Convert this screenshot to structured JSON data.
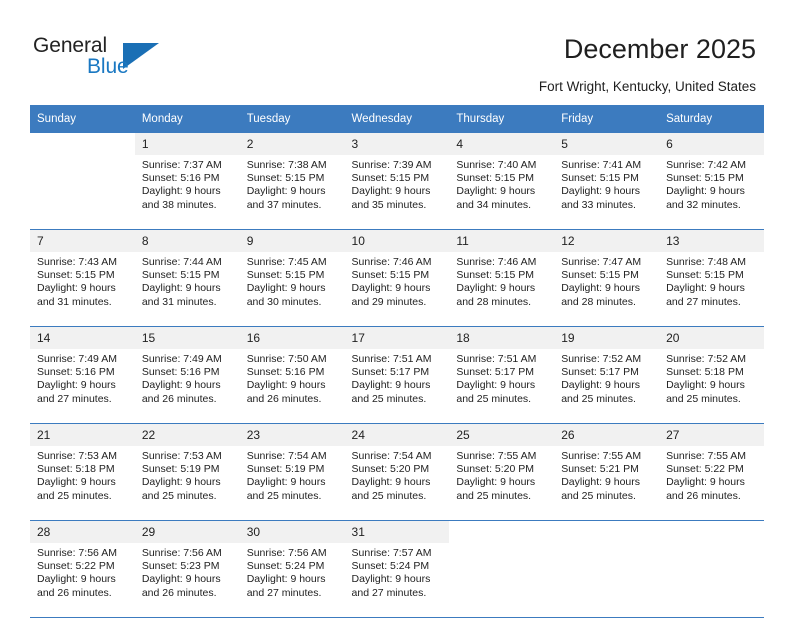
{
  "brand": {
    "name_part1": "General",
    "name_part2": "Blue",
    "flag_color": "#1a6fb5"
  },
  "header": {
    "title": "December 2025",
    "subtitle": "Fort Wright, Kentucky, United States"
  },
  "theme": {
    "header_blue": "#3c7bbf",
    "daynum_bg": "#f1f1f1",
    "text": "#222222"
  },
  "weekdays": [
    "Sunday",
    "Monday",
    "Tuesday",
    "Wednesday",
    "Thursday",
    "Friday",
    "Saturday"
  ],
  "weeks": [
    [
      {
        "day": "",
        "lines": []
      },
      {
        "day": "1",
        "lines": [
          "Sunrise: 7:37 AM",
          "Sunset: 5:16 PM",
          "Daylight: 9 hours",
          "and 38 minutes."
        ]
      },
      {
        "day": "2",
        "lines": [
          "Sunrise: 7:38 AM",
          "Sunset: 5:15 PM",
          "Daylight: 9 hours",
          "and 37 minutes."
        ]
      },
      {
        "day": "3",
        "lines": [
          "Sunrise: 7:39 AM",
          "Sunset: 5:15 PM",
          "Daylight: 9 hours",
          "and 35 minutes."
        ]
      },
      {
        "day": "4",
        "lines": [
          "Sunrise: 7:40 AM",
          "Sunset: 5:15 PM",
          "Daylight: 9 hours",
          "and 34 minutes."
        ]
      },
      {
        "day": "5",
        "lines": [
          "Sunrise: 7:41 AM",
          "Sunset: 5:15 PM",
          "Daylight: 9 hours",
          "and 33 minutes."
        ]
      },
      {
        "day": "6",
        "lines": [
          "Sunrise: 7:42 AM",
          "Sunset: 5:15 PM",
          "Daylight: 9 hours",
          "and 32 minutes."
        ]
      }
    ],
    [
      {
        "day": "7",
        "lines": [
          "Sunrise: 7:43 AM",
          "Sunset: 5:15 PM",
          "Daylight: 9 hours",
          "and 31 minutes."
        ]
      },
      {
        "day": "8",
        "lines": [
          "Sunrise: 7:44 AM",
          "Sunset: 5:15 PM",
          "Daylight: 9 hours",
          "and 31 minutes."
        ]
      },
      {
        "day": "9",
        "lines": [
          "Sunrise: 7:45 AM",
          "Sunset: 5:15 PM",
          "Daylight: 9 hours",
          "and 30 minutes."
        ]
      },
      {
        "day": "10",
        "lines": [
          "Sunrise: 7:46 AM",
          "Sunset: 5:15 PM",
          "Daylight: 9 hours",
          "and 29 minutes."
        ]
      },
      {
        "day": "11",
        "lines": [
          "Sunrise: 7:46 AM",
          "Sunset: 5:15 PM",
          "Daylight: 9 hours",
          "and 28 minutes."
        ]
      },
      {
        "day": "12",
        "lines": [
          "Sunrise: 7:47 AM",
          "Sunset: 5:15 PM",
          "Daylight: 9 hours",
          "and 28 minutes."
        ]
      },
      {
        "day": "13",
        "lines": [
          "Sunrise: 7:48 AM",
          "Sunset: 5:15 PM",
          "Daylight: 9 hours",
          "and 27 minutes."
        ]
      }
    ],
    [
      {
        "day": "14",
        "lines": [
          "Sunrise: 7:49 AM",
          "Sunset: 5:16 PM",
          "Daylight: 9 hours",
          "and 27 minutes."
        ]
      },
      {
        "day": "15",
        "lines": [
          "Sunrise: 7:49 AM",
          "Sunset: 5:16 PM",
          "Daylight: 9 hours",
          "and 26 minutes."
        ]
      },
      {
        "day": "16",
        "lines": [
          "Sunrise: 7:50 AM",
          "Sunset: 5:16 PM",
          "Daylight: 9 hours",
          "and 26 minutes."
        ]
      },
      {
        "day": "17",
        "lines": [
          "Sunrise: 7:51 AM",
          "Sunset: 5:17 PM",
          "Daylight: 9 hours",
          "and 25 minutes."
        ]
      },
      {
        "day": "18",
        "lines": [
          "Sunrise: 7:51 AM",
          "Sunset: 5:17 PM",
          "Daylight: 9 hours",
          "and 25 minutes."
        ]
      },
      {
        "day": "19",
        "lines": [
          "Sunrise: 7:52 AM",
          "Sunset: 5:17 PM",
          "Daylight: 9 hours",
          "and 25 minutes."
        ]
      },
      {
        "day": "20",
        "lines": [
          "Sunrise: 7:52 AM",
          "Sunset: 5:18 PM",
          "Daylight: 9 hours",
          "and 25 minutes."
        ]
      }
    ],
    [
      {
        "day": "21",
        "lines": [
          "Sunrise: 7:53 AM",
          "Sunset: 5:18 PM",
          "Daylight: 9 hours",
          "and 25 minutes."
        ]
      },
      {
        "day": "22",
        "lines": [
          "Sunrise: 7:53 AM",
          "Sunset: 5:19 PM",
          "Daylight: 9 hours",
          "and 25 minutes."
        ]
      },
      {
        "day": "23",
        "lines": [
          "Sunrise: 7:54 AM",
          "Sunset: 5:19 PM",
          "Daylight: 9 hours",
          "and 25 minutes."
        ]
      },
      {
        "day": "24",
        "lines": [
          "Sunrise: 7:54 AM",
          "Sunset: 5:20 PM",
          "Daylight: 9 hours",
          "and 25 minutes."
        ]
      },
      {
        "day": "25",
        "lines": [
          "Sunrise: 7:55 AM",
          "Sunset: 5:20 PM",
          "Daylight: 9 hours",
          "and 25 minutes."
        ]
      },
      {
        "day": "26",
        "lines": [
          "Sunrise: 7:55 AM",
          "Sunset: 5:21 PM",
          "Daylight: 9 hours",
          "and 25 minutes."
        ]
      },
      {
        "day": "27",
        "lines": [
          "Sunrise: 7:55 AM",
          "Sunset: 5:22 PM",
          "Daylight: 9 hours",
          "and 26 minutes."
        ]
      }
    ],
    [
      {
        "day": "28",
        "lines": [
          "Sunrise: 7:56 AM",
          "Sunset: 5:22 PM",
          "Daylight: 9 hours",
          "and 26 minutes."
        ]
      },
      {
        "day": "29",
        "lines": [
          "Sunrise: 7:56 AM",
          "Sunset: 5:23 PM",
          "Daylight: 9 hours",
          "and 26 minutes."
        ]
      },
      {
        "day": "30",
        "lines": [
          "Sunrise: 7:56 AM",
          "Sunset: 5:24 PM",
          "Daylight: 9 hours",
          "and 27 minutes."
        ]
      },
      {
        "day": "31",
        "lines": [
          "Sunrise: 7:57 AM",
          "Sunset: 5:24 PM",
          "Daylight: 9 hours",
          "and 27 minutes."
        ]
      },
      {
        "day": "",
        "lines": []
      },
      {
        "day": "",
        "lines": []
      },
      {
        "day": "",
        "lines": []
      }
    ]
  ]
}
